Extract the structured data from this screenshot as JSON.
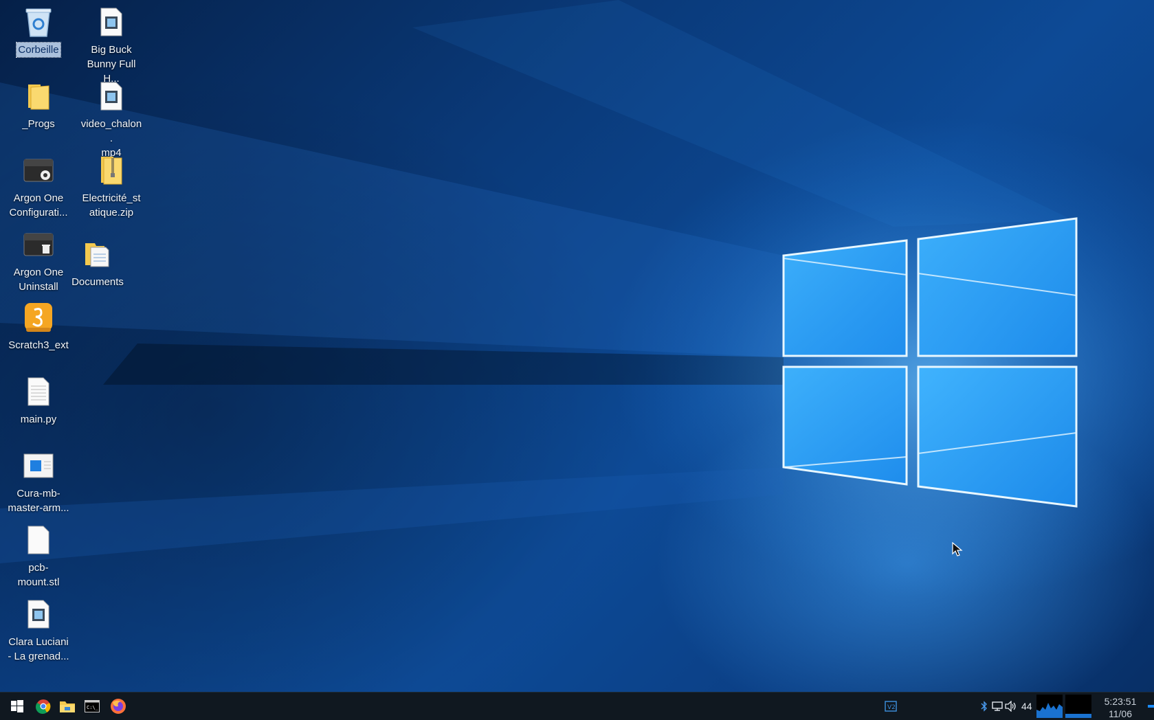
{
  "desktop": {
    "icons": [
      {
        "label": "Corbeille",
        "icon": "recycle-bin-icon",
        "selected": true
      },
      {
        "label": "Big Buck\nBunny Full H...",
        "icon": "video-file-icon"
      },
      {
        "label": "_Progs",
        "icon": "folder-icon"
      },
      {
        "label": "video_chalon.\nmp4",
        "icon": "video-file-icon"
      },
      {
        "label": "Argon One\nConfigurati...",
        "icon": "argon-config-icon"
      },
      {
        "label": "Electricité_st\natique.zip",
        "icon": "zip-folder-icon"
      },
      {
        "label": "Argon One\nUninstall",
        "icon": "argon-uninstall-icon"
      },
      {
        "label": "Documents",
        "icon": "documents-folder-icon"
      },
      {
        "label": "Scratch3_ext",
        "icon": "scratch-icon"
      },
      {
        "label": "main.py",
        "icon": "text-file-icon"
      },
      {
        "label": "Cura-mb-\nmaster-arm...",
        "icon": "cura-app-icon"
      },
      {
        "label": "pcb-\nmount.stl",
        "icon": "blank-file-icon"
      },
      {
        "label": "Clara Luciani\n- La grenad...",
        "icon": "video-file-icon"
      }
    ]
  },
  "taskbar": {
    "apps": [
      {
        "name": "start-menu",
        "icon": "windows-start-icon"
      },
      {
        "name": "chrome",
        "icon": "chrome-icon"
      },
      {
        "name": "file-manager",
        "icon": "file-manager-icon"
      },
      {
        "name": "terminal",
        "icon": "terminal-icon"
      },
      {
        "name": "firefox",
        "icon": "firefox-icon"
      }
    ],
    "tray": {
      "vnc_icon": "vnc-icon",
      "bluetooth_icon": "bluetooth-icon",
      "network_icon": "network-icon",
      "volume_icon": "volume-icon",
      "volume_level": "44",
      "cpu_graph": "cpu-monitor-icon",
      "clock_time": "5:23:51",
      "clock_date": "11/06"
    }
  },
  "colors": {
    "taskbar_bg": "#101820",
    "selection": "#c8dcf5",
    "accent": "#1a8cff"
  }
}
